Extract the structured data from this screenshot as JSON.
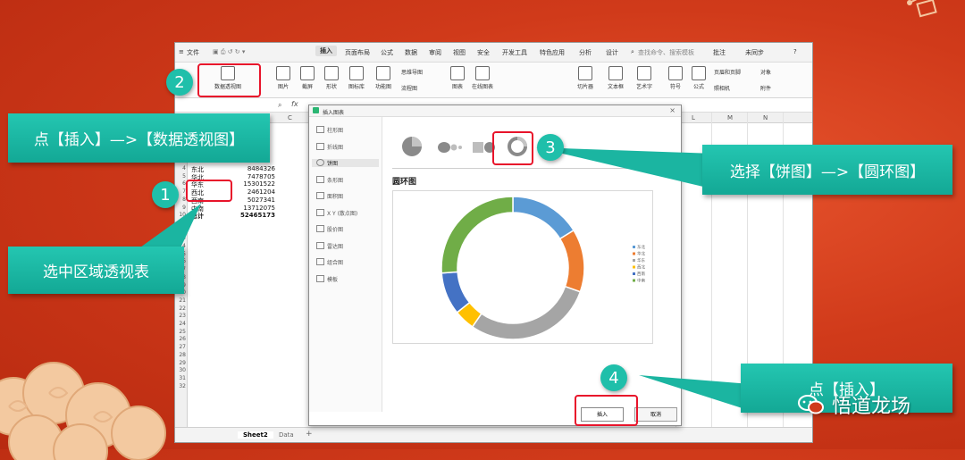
{
  "window": {
    "menus": [
      "文件",
      "插入",
      "页面布局",
      "公式",
      "数据",
      "审阅",
      "视图",
      "安全",
      "开发工具",
      "特色应用",
      "分析",
      "设计"
    ],
    "search_placeholder": "查找命令、搜索模板",
    "right_menus": [
      "批注",
      "未同步"
    ]
  },
  "ribbon": {
    "pivot_label": "数据透视图",
    "items": [
      "图片",
      "截屏",
      "形状",
      "图标库",
      "功能图",
      "图表",
      "在线图表",
      "切片器",
      "文本框",
      "艺术字",
      "符号",
      "公式"
    ],
    "small_items": [
      "思维导图",
      "流程图",
      "页眉和页脚",
      "对象",
      "照相机",
      "附件"
    ]
  },
  "formula_bar": {
    "fx": "fx"
  },
  "columns": [
    "C",
    "L",
    "M",
    "N"
  ],
  "sheet": {
    "rows": [
      {
        "num": "4",
        "region": "东北",
        "value": "8484326"
      },
      {
        "num": "5",
        "region": "华北",
        "value": "7478705"
      },
      {
        "num": "6",
        "region": "华东",
        "value": "15301522"
      },
      {
        "num": "7",
        "region": "西北",
        "value": "2461204"
      },
      {
        "num": "8",
        "region": "西南",
        "value": "5027341"
      },
      {
        "num": "9",
        "region": "中南",
        "value": "13712075"
      },
      {
        "num": "10",
        "region": "总计",
        "value": "52465173"
      }
    ],
    "empty_rows": [
      "11",
      "12",
      "13",
      "14",
      "15",
      "16",
      "17",
      "18",
      "19",
      "20",
      "21",
      "22",
      "23",
      "24",
      "25",
      "26",
      "27",
      "28",
      "29",
      "30",
      "31",
      "32"
    ],
    "tabs": [
      "Sheet2",
      "Data"
    ]
  },
  "dialog": {
    "title": "插入图表",
    "chart_types": [
      "柱形图",
      "折线图",
      "饼图",
      "条形图",
      "面积图",
      "X Y (散点图)",
      "股价图",
      "雷达图",
      "组合图",
      "模板"
    ],
    "selected_type": "饼图",
    "preview_title": "圆环图",
    "insert_label": "插入",
    "cancel_label": "取消"
  },
  "chart_data": {
    "type": "pie",
    "variant": "doughnut",
    "title": "圆环图",
    "categories": [
      "东北",
      "华北",
      "华东",
      "西北",
      "西南",
      "中南"
    ],
    "values": [
      8484326,
      7478705,
      15301522,
      2461204,
      5027341,
      13712075
    ],
    "colors": [
      "#5b9bd5",
      "#ed7d31",
      "#a5a5a5",
      "#ffc000",
      "#4472c4",
      "#70ad47"
    ],
    "legend": "right"
  },
  "callouts": {
    "step1": "选中区域透视表",
    "step2": "点【插入】—>【数据透视图】",
    "step3": "选择【饼图】—>【圆环图】",
    "step4": "点【插入】",
    "num1": "1",
    "num2": "2",
    "num3": "3",
    "num4": "4"
  },
  "watermark": "悟道龙场"
}
